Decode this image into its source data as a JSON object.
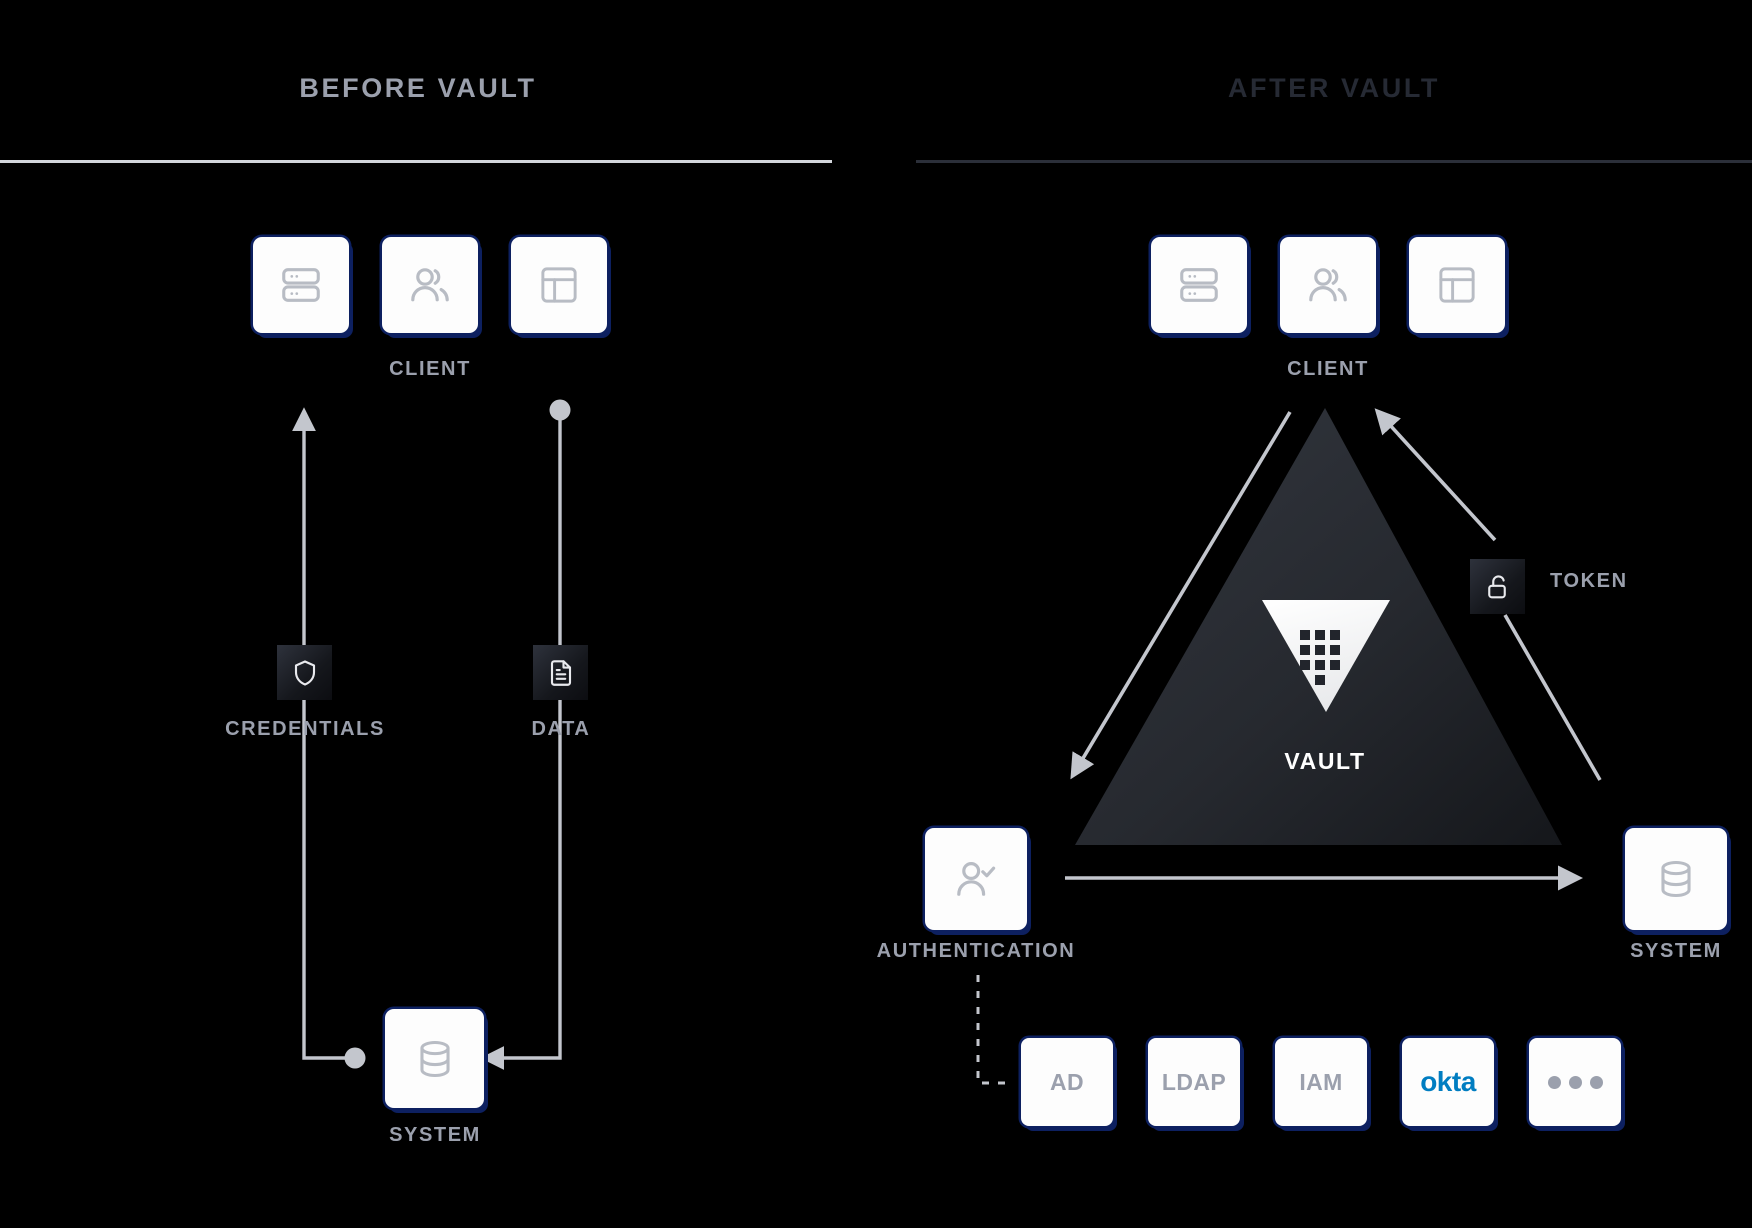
{
  "sections": {
    "before": {
      "title": "BEFORE VAULT"
    },
    "after": {
      "title": "AFTER VAULT"
    }
  },
  "before": {
    "client_label": "CLIENT",
    "client_cards": [
      {
        "icon": "server-stack-icon"
      },
      {
        "icon": "users-icon"
      },
      {
        "icon": "dashboard-layout-icon"
      }
    ],
    "credentials_label": "CREDENTIALS",
    "credentials_icon": "shield-icon",
    "data_label": "DATA",
    "data_icon": "document-icon",
    "system_label": "SYSTEM",
    "system_icon": "database-icon"
  },
  "after": {
    "client_label": "CLIENT",
    "client_cards": [
      {
        "icon": "server-stack-icon"
      },
      {
        "icon": "users-icon"
      },
      {
        "icon": "dashboard-layout-icon"
      }
    ],
    "vault_label": "VAULT",
    "vault_icon": "vault-triangle-logo",
    "token_label": "TOKEN",
    "token_icon": "unlocked-padlock-icon",
    "authentication_label": "AUTHENTICATION",
    "authentication_icon": "user-check-icon",
    "system_label": "SYSTEM",
    "system_icon": "database-icon",
    "providers": [
      {
        "label": "AD"
      },
      {
        "label": "LDAP"
      },
      {
        "label": "IAM"
      },
      {
        "label": "okta"
      },
      {
        "label": "•••"
      }
    ]
  },
  "colors": {
    "background": "#000000",
    "card_shadow_navy": "#0d2060",
    "label_gray": "#9ba0ad",
    "connector_gray": "#c3c6cd",
    "title_before": "#9ba0ad",
    "title_after": "#262a34",
    "okta_blue": "#007dc1",
    "vault_triangle_dark": "#2b2e37"
  }
}
